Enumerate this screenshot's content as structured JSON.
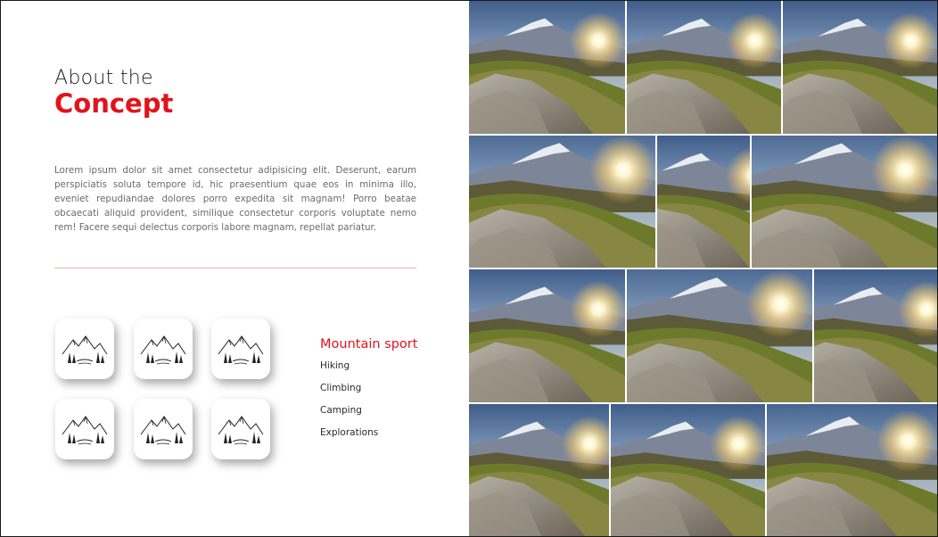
{
  "heading": {
    "line1": "About the",
    "line2": "Concept"
  },
  "body": "Lorem ipsum dolor sit amet consectetur adipisicing elit. Deserunt, earum perspiciatis soluta tempore id, hic praesentium quae eos in minima illo, eveniet repudiandae dolores porro expedita sit magnam! Porro beatae obcaecati aliquid provident, similique consectetur corporis voluptate nemo rem! Facere sequi delectus corporis labore magnam, repellat pariatur.",
  "icons": [
    "mountain-sketch-icon",
    "mountain-sketch-icon",
    "mountain-sketch-icon",
    "mountain-sketch-icon",
    "mountain-sketch-icon",
    "mountain-sketch-icon"
  ],
  "list": {
    "title": "Mountain sport",
    "items": [
      "Hiking",
      "Climbing",
      "Camping",
      "Explorations"
    ]
  },
  "colors": {
    "accent": "#e3121b",
    "divider": "#e8b9ad"
  }
}
